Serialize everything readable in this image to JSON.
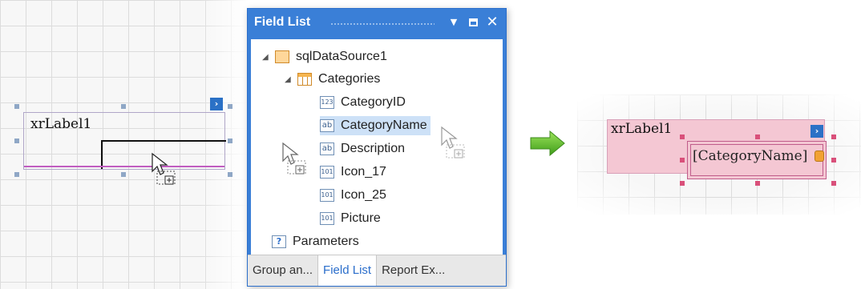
{
  "left_canvas": {
    "label_text": "xrLabel1"
  },
  "field_list": {
    "title": "Field List",
    "datasource": "sqlDataSource1",
    "table": "Categories",
    "fields": [
      {
        "name": "CategoryID",
        "icon": "numeric-field-icon",
        "icon_text": "123"
      },
      {
        "name": "CategoryName",
        "icon": "string-field-icon",
        "icon_text": "ab"
      },
      {
        "name": "Description",
        "icon": "string-field-icon",
        "icon_text": "ab"
      },
      {
        "name": "Icon_17",
        "icon": "binary-field-icon",
        "icon_text": "101"
      },
      {
        "name": "Icon_25",
        "icon": "binary-field-icon",
        "icon_text": "101"
      },
      {
        "name": "Picture",
        "icon": "binary-field-icon",
        "icon_text": "101"
      }
    ],
    "parameters": "Parameters",
    "selected_field": "CategoryName",
    "tabs": [
      "Group an...",
      "Field List",
      "Report Ex..."
    ],
    "active_tab": "Field List"
  },
  "right_canvas": {
    "label_text": "xrLabel1",
    "bound_field_text": "[CategoryName]"
  },
  "colors": {
    "panel_header": "#3a7fd7",
    "arrow": "#5fbf2a",
    "bound_label": "#f4c7d3",
    "handle_pink": "#d9507a"
  }
}
